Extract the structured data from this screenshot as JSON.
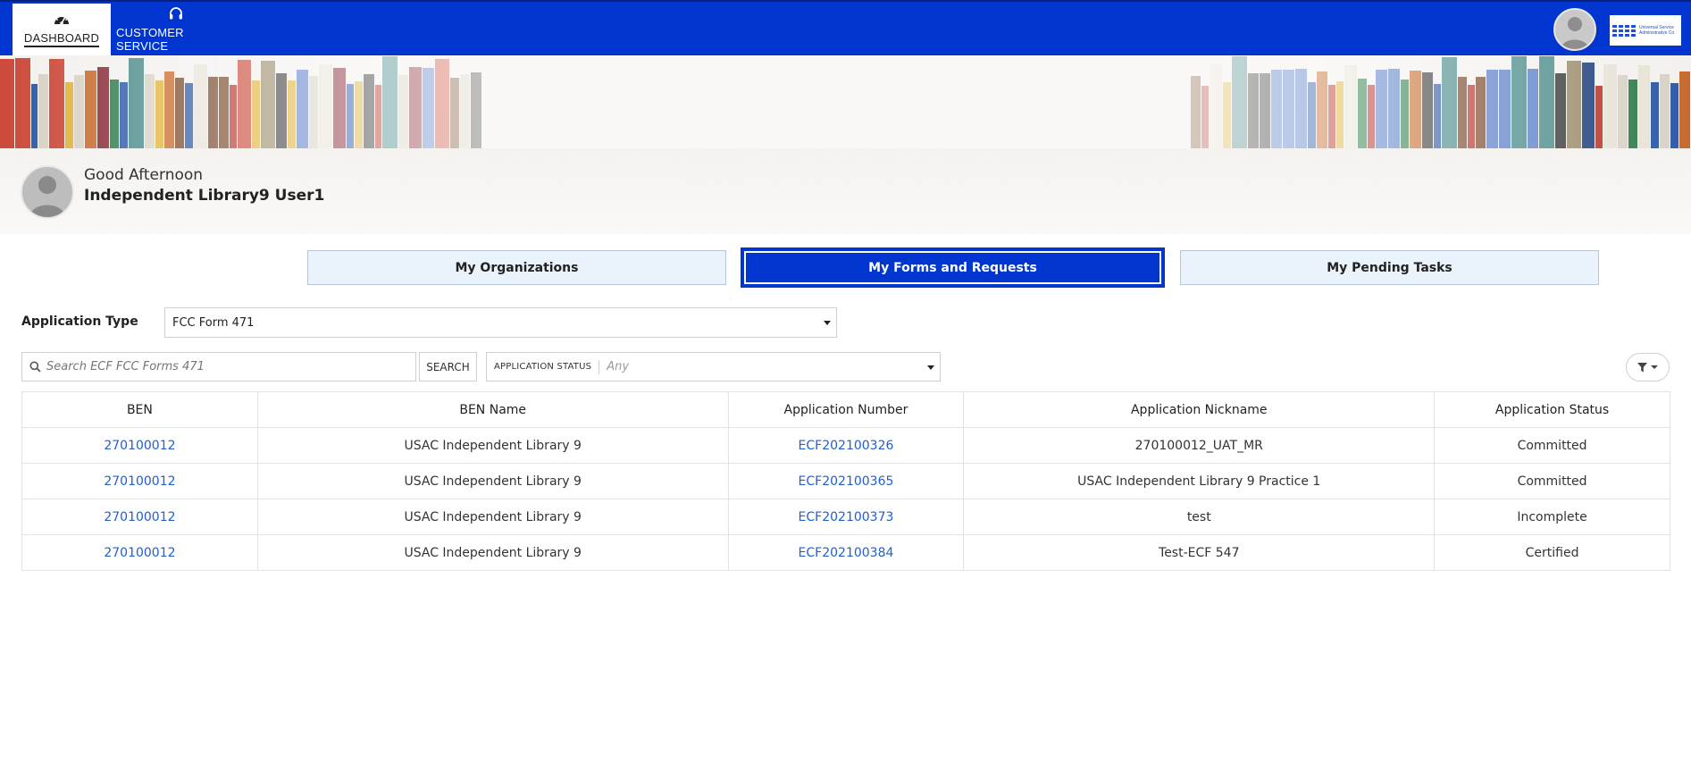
{
  "nav": {
    "dashboard_label": "DASHBOARD",
    "customer_service_label": "CUSTOMER SERVICE",
    "logo_text": "Universal Service Administrative Co."
  },
  "greeting": {
    "salutation": "Good Afternoon",
    "user_name": "Independent Library9 User1"
  },
  "tabs": [
    {
      "label": "My Organizations",
      "active": false
    },
    {
      "label": "My Forms and Requests",
      "active": true
    },
    {
      "label": "My Pending Tasks",
      "active": false
    }
  ],
  "filters": {
    "application_type_label": "Application Type",
    "application_type_value": "FCC Form 471",
    "search_placeholder": "Search ECF FCC Forms 471",
    "search_button": "SEARCH",
    "status_label": "APPLICATION STATUS",
    "status_value": "Any"
  },
  "table": {
    "columns": [
      "BEN",
      "BEN Name",
      "Application Number",
      "Application Nickname",
      "Application Status"
    ],
    "rows": [
      {
        "ben": "270100012",
        "ben_name": "USAC Independent Library 9",
        "app_number": "ECF202100326",
        "nickname": "270100012_UAT_MR",
        "status": "Committed"
      },
      {
        "ben": "270100012",
        "ben_name": "USAC Independent Library 9",
        "app_number": "ECF202100365",
        "nickname": "USAC Independent Library 9 Practice 1",
        "status": "Committed"
      },
      {
        "ben": "270100012",
        "ben_name": "USAC Independent Library 9",
        "app_number": "ECF202100373",
        "nickname": "test",
        "status": "Incomplete"
      },
      {
        "ben": "270100012",
        "ben_name": "USAC Independent Library 9",
        "app_number": "ECF202100384",
        "nickname": "Test-ECF 547",
        "status": "Certified"
      }
    ]
  },
  "colors": {
    "brand_blue": "#0036cf",
    "link_blue": "#1f5fcf",
    "tab_inactive_bg": "#eaf3fc"
  },
  "icons": {
    "dashboard": "speedometer-icon",
    "customer_service": "headset-icon",
    "search": "search-icon",
    "filter": "filter-icon"
  }
}
